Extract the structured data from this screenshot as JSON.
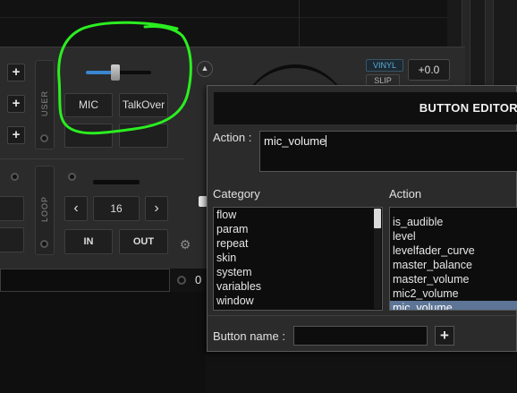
{
  "deck": {
    "user_label": "USER",
    "loop_label": "LOOP",
    "mic_button": "MIC",
    "talkover_button": "TalkOver",
    "loop_length": "16",
    "prev_glyph": "‹",
    "next_glyph": "›",
    "in_button": "IN",
    "out_button": "OUT",
    "plus_glyph": "+",
    "vinyl_button": "VINYL",
    "slip_button": "SLIP",
    "pitch_value": "+0.0",
    "bottom_value": "0",
    "mic_slider_level": 0.45,
    "accent_color": "#3a86d1"
  },
  "annotation": {
    "color": "#2bee20"
  },
  "editor": {
    "title": "BUTTON EDITOR",
    "action_label": "Action :",
    "action_value": "mic_volume",
    "category_header": "Category",
    "action_header": "Action",
    "categories": [
      "flow",
      "param",
      "repeat",
      "skin",
      "system",
      "variables",
      "window"
    ],
    "actions": [
      "is_audible",
      "level",
      "levelfader_curve",
      "master_balance",
      "master_volume",
      "mic2_volume",
      "mic_volume"
    ],
    "selected_action": "mic_volume",
    "button_name_label": "Button name :",
    "button_name_value": "",
    "add_glyph": "+"
  },
  "icons": [
    "eject-icon",
    "gear-icon",
    "chevron-left-icon",
    "chevron-right-icon",
    "plus-icon"
  ]
}
